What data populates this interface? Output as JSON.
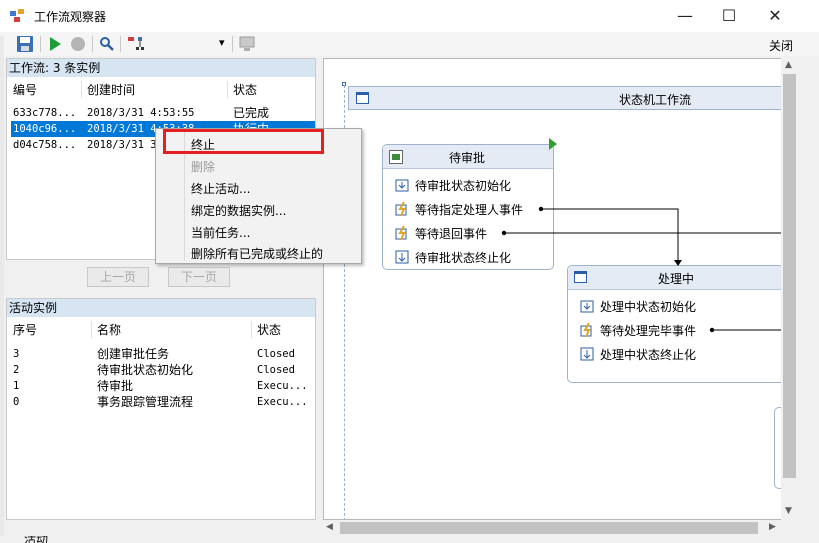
{
  "window": {
    "title": "工作流观察器",
    "close_label": "关闭",
    "minimize_glyph": "—",
    "maximize_glyph": "☐",
    "close_glyph": "✕"
  },
  "toolbar": {
    "icons": [
      "save-icon",
      "play-icon",
      "stop-icon",
      "zoom-icon",
      "workflow-dropdown-icon",
      "monitor-icon"
    ],
    "dropdown_arrow": "▾"
  },
  "workflow_panel": {
    "header": "工作流: 3 条实例",
    "columns": [
      "编号",
      "创建时间",
      "状态"
    ],
    "rows": [
      {
        "id": "633c778...",
        "created": "2018/3/31 4:53:55",
        "status": "已完成"
      },
      {
        "id": "1040c96...",
        "created": "2018/3/31 4:53:38",
        "status": "执行中"
      },
      {
        "id": "d04c758...",
        "created": "2018/3/31 3",
        "status": ""
      }
    ]
  },
  "pager": {
    "prev": "上一页",
    "next": "下一页"
  },
  "activity_panel": {
    "header": "活动实例",
    "columns": [
      "序号",
      "名称",
      "状态"
    ],
    "rows": [
      {
        "seq": "3",
        "name": "创建审批任务",
        "status": "Closed"
      },
      {
        "seq": "2",
        "name": "待审批状态初始化",
        "status": "Closed"
      },
      {
        "seq": "1",
        "name": "待审批",
        "status": "Execu..."
      },
      {
        "seq": "0",
        "name": "事务跟踪管理流程",
        "status": "Execu..."
      }
    ]
  },
  "context_menu": {
    "items": [
      {
        "label": "终止",
        "enabled": true
      },
      {
        "label": "删除",
        "enabled": false
      },
      {
        "label": "终止活动...",
        "enabled": true
      },
      {
        "label": "绑定的数据实例...",
        "enabled": true
      },
      {
        "label": "当前任务...",
        "enabled": true
      },
      {
        "label": "删除所有已完成或终止的",
        "enabled": true
      }
    ],
    "highlight_color": "#e32121"
  },
  "designer": {
    "workflow_title": "状态机工作流",
    "states": [
      {
        "title": "待审批",
        "activities": [
          {
            "label": "待审批状态初始化",
            "icon": "init-icon"
          },
          {
            "label": "等待指定处理人事件",
            "icon": "event-icon"
          },
          {
            "label": "等待退回事件",
            "icon": "event-icon"
          },
          {
            "label": "待审批状态终止化",
            "icon": "finalize-icon"
          }
        ]
      },
      {
        "title": "处理中",
        "activities": [
          {
            "label": "处理中状态初始化",
            "icon": "init-icon"
          },
          {
            "label": "等待处理完毕事件",
            "icon": "event-icon"
          },
          {
            "label": "处理中状态终止化",
            "icon": "finalize-icon"
          }
        ]
      }
    ]
  },
  "scroll_arrows": {
    "up": "▲",
    "down": "▼",
    "left": "◀",
    "right": "▶"
  },
  "partial_text": {
    "left_tab": "活动"
  },
  "colors": {
    "selection": "#0078d7",
    "header_bg": "#d7e4f2",
    "state_header": "#e4ebf5",
    "start_marker": "#2ca02c"
  }
}
